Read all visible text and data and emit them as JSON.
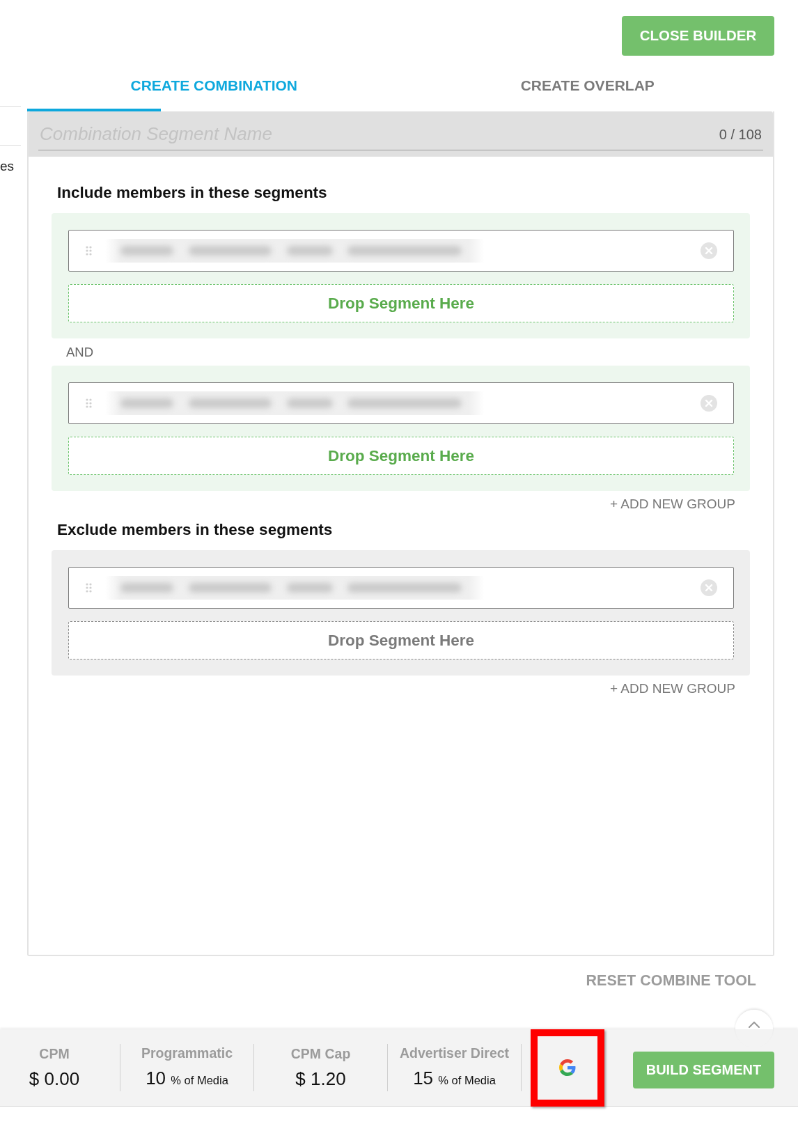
{
  "left_panel": {
    "text": "es"
  },
  "close_button": {
    "label": "CLOSE BUILDER"
  },
  "tabs": [
    {
      "label": "CREATE COMBINATION",
      "selected": true
    },
    {
      "label": "CREATE OVERLAP",
      "selected": false
    }
  ],
  "name_field": {
    "placeholder": "Combination Segment Name",
    "counter": "0 / 108"
  },
  "sections": [
    {
      "kind": "include",
      "heading": "Include members in these segments",
      "joiner": "AND",
      "groups": [
        {
          "segments": [
            {
              "blurred": true
            }
          ],
          "drop_label": "Drop Segment Here"
        },
        {
          "segments": [
            {
              "blurred": true
            }
          ],
          "drop_label": "Drop Segment Here"
        }
      ],
      "add_group": "+ ADD NEW GROUP"
    },
    {
      "kind": "exclude",
      "heading": "Exclude members in these segments",
      "groups": [
        {
          "segments": [
            {
              "blurred": true
            }
          ],
          "drop_label": "Drop Segment Here"
        }
      ],
      "add_group": "+ ADD NEW GROUP"
    }
  ],
  "reset_button": {
    "label": "RESET COMBINE TOOL"
  },
  "footer": {
    "stats": [
      {
        "label": "CPM",
        "value": "$ 0.00"
      },
      {
        "label": "Programmatic",
        "value": "10",
        "unit": "% of Media"
      },
      {
        "label": "CPM Cap",
        "value": "$ 1.20"
      },
      {
        "label": "Advertiser Direct",
        "value": "15",
        "unit": "% of Media"
      }
    ],
    "integration_button": {
      "highlighted": true
    },
    "build_button": {
      "label": "BUILD SEGMENT"
    }
  }
}
